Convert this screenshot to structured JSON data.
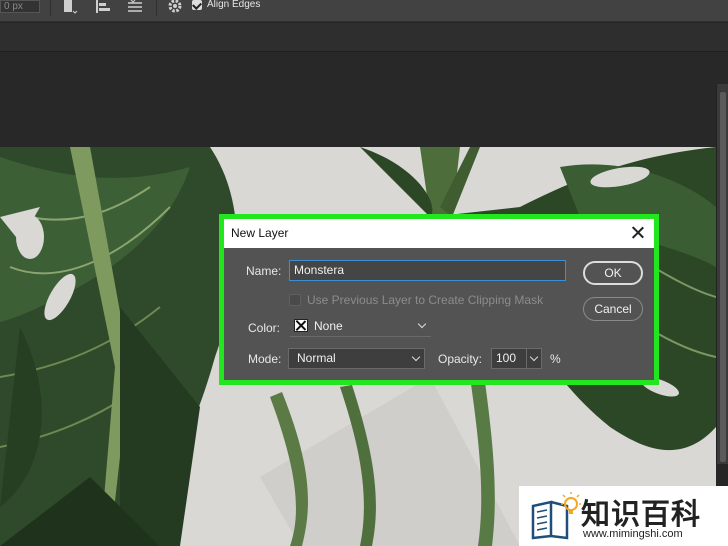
{
  "options_bar": {
    "px_field_value": "0 px",
    "align_edges_label": "Align Edges",
    "align_edges_checked": true
  },
  "dialog": {
    "title": "New Layer",
    "name_label": "Name:",
    "name_value": "Monstera",
    "clipping_label": "Use Previous Layer to Create Clipping Mask",
    "clipping_checked": false,
    "color_label": "Color:",
    "color_value": "None",
    "mode_label": "Mode:",
    "mode_value": "Normal",
    "opacity_label": "Opacity:",
    "opacity_value": "100",
    "opacity_unit": "%",
    "ok_label": "OK",
    "cancel_label": "Cancel",
    "highlight_color": "#22e61e"
  },
  "watermark": {
    "chinese_text": "知识百科",
    "url_text": "www.mimingshi.com",
    "logo_icon": "book-lightbulb-icon"
  },
  "colors": {
    "ui_dark": "#262626",
    "dialog_bg": "#535353",
    "accent_focus": "#3b8fd6"
  }
}
